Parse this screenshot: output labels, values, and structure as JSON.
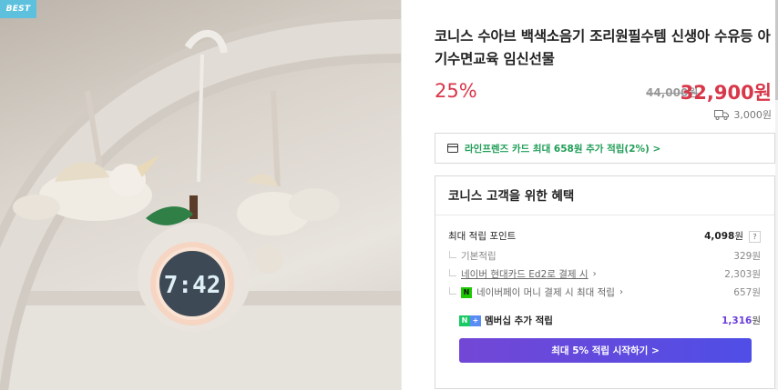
{
  "image": {
    "badge": "BEST",
    "clock_time": "7:42"
  },
  "product": {
    "title": "코니스 수아브 백색소음기 조리원필수템 신생아 수유등 아기수면교육 임신선물",
    "discount": "25%",
    "original_price": "44,000원",
    "sale_price": "32,900원",
    "shipping_fee": "3,000원"
  },
  "card_promo": {
    "text": "라인프렌즈 카드 최대 658원 추가 적립(2%) >"
  },
  "benefits": {
    "title": "코니스 고객을 위한 혜택",
    "max_points_label": "최대 적립 포인트",
    "max_points_value": "4,098",
    "won": "원",
    "help_icon": "?",
    "rows": [
      {
        "label": "기본적립",
        "value": "329원"
      },
      {
        "label": "네이버 현대카드 Ed2로 결제 시",
        "value": "2,303원"
      },
      {
        "label": "네이버페이 머니 결제 시 최대 적립",
        "value": "657원"
      }
    ],
    "npay_icon": "N",
    "membership_label": "멤버십 추가 적립",
    "membership_value": "1,316",
    "membership_icon_n": "N",
    "membership_icon_plus": "+",
    "cta_label": "최대 5% 적립 시작하기 >"
  },
  "colors": {
    "price_red": "#d8374a",
    "promo_green": "#1f9d56",
    "membership_purple": "#6a3fd8",
    "badge_blue": "#5dc1dd"
  },
  "icons": {
    "shipping": "truck-icon",
    "card": "credit-card-icon",
    "npay": "naver-pay-icon",
    "membership": "naver-plus-icon",
    "help": "question-icon"
  }
}
